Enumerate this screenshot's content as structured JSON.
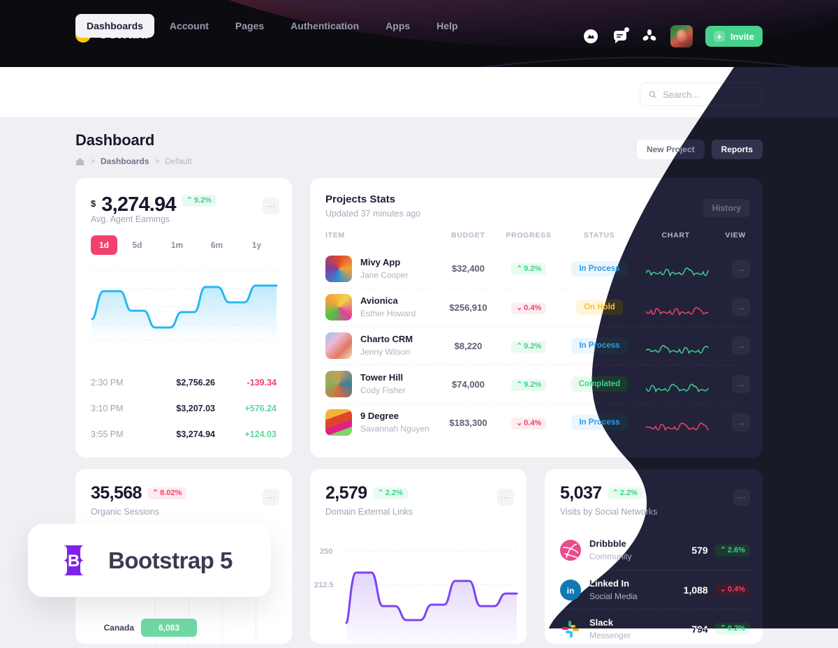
{
  "brand": {
    "name": "Oswald",
    "logo_icon": "circle-dot-logo",
    "logo_color": "#F5C60B"
  },
  "topbar": {
    "icons": [
      {
        "name": "download-icon",
        "badge": false
      },
      {
        "name": "message-icon",
        "badge": true
      },
      {
        "name": "share-icon",
        "badge": false
      }
    ],
    "avatar_name": "user-avatar",
    "invite_label": "Invite",
    "invite_color": "#47D18C"
  },
  "nav": {
    "items": [
      {
        "label": "Dashboards",
        "active": true
      },
      {
        "label": "Account",
        "active": false
      },
      {
        "label": "Pages",
        "active": false
      },
      {
        "label": "Authentication",
        "active": false
      },
      {
        "label": "Apps",
        "active": false
      },
      {
        "label": "Help",
        "active": false
      }
    ]
  },
  "search": {
    "placeholder": "Search...",
    "value": "",
    "icon": "search-icon"
  },
  "page": {
    "title": "Dashboard",
    "breadcrumb": {
      "home_icon": "home-icon",
      "sep": ">",
      "items": [
        "Dashboards",
        "Default"
      ]
    },
    "buttons": {
      "secondary": "New Project",
      "primary": "Reports"
    }
  },
  "earnings": {
    "currency": "$",
    "amount": "3,274.94",
    "change": "9.2%",
    "change_dir": "up",
    "label": "Avg. Agent Earnings",
    "menu_icon": "ellipsis-icon",
    "ranges": [
      {
        "label": "1d",
        "active": true
      },
      {
        "label": "5d",
        "active": false
      },
      {
        "label": "1m",
        "active": false
      },
      {
        "label": "6m",
        "active": false
      },
      {
        "label": "1y",
        "active": false
      }
    ],
    "transactions": [
      {
        "time": "2:30 PM",
        "value": "$2,756.26",
        "delta": "-139.34",
        "dir": "down"
      },
      {
        "time": "3:10 PM",
        "value": "$3,207.03",
        "delta": "+576.24",
        "dir": "up"
      },
      {
        "time": "3:55 PM",
        "value": "$3,274.94",
        "delta": "+124.03",
        "dir": "up"
      }
    ]
  },
  "projects": {
    "title": "Projects Stats",
    "subtitle": "Updated 37 minutes ago",
    "history_label": "History",
    "columns": [
      "ITEM",
      "BUDGET",
      "PROGRESS",
      "STATUS",
      "CHART",
      "VIEW"
    ],
    "rows": [
      {
        "name": "Mivy App",
        "person": "Jane Cooper",
        "budget": "$32,400",
        "progress": "9.2%",
        "progress_dir": "up",
        "status": "In Process",
        "status_kind": "process",
        "chart_color": "#3ECF8E",
        "view_icon": "arrow-right-icon"
      },
      {
        "name": "Avionica",
        "person": "Esther Howard",
        "budget": "$256,910",
        "progress": "0.4%",
        "progress_dir": "down",
        "status": "On Hold",
        "status_kind": "hold",
        "chart_color": "#F1416C",
        "view_icon": "arrow-right-icon"
      },
      {
        "name": "Charto CRM",
        "person": "Jenny Wilson",
        "budget": "$8,220",
        "progress": "9.2%",
        "progress_dir": "up",
        "status": "In Process",
        "status_kind": "process",
        "chart_color": "#3ECF8E",
        "view_icon": "arrow-right-icon"
      },
      {
        "name": "Tower Hill",
        "person": "Cody Fisher",
        "budget": "$74,000",
        "progress": "9.2%",
        "progress_dir": "up",
        "status": "Complated",
        "status_kind": "complete",
        "chart_color": "#3ECF8E",
        "view_icon": "arrow-right-icon"
      },
      {
        "name": "9 Degree",
        "person": "Savannah Nguyen",
        "budget": "$183,300",
        "progress": "0.4%",
        "progress_dir": "down",
        "status": "In Process",
        "status_kind": "process",
        "chart_color": "#F1416C",
        "view_icon": "arrow-right-icon"
      }
    ]
  },
  "organic": {
    "number": "35,568",
    "change": "8.02%",
    "change_dir": "up",
    "change_kind": "red",
    "label": "Organic Sessions",
    "menu_icon": "ellipsis-icon",
    "bar_label": "Canada",
    "bar_value": "6,083"
  },
  "domain": {
    "number": "2,579",
    "change": "2.2%",
    "change_dir": "up",
    "label": "Domain External Links",
    "menu_icon": "ellipsis-icon",
    "y_ticks": [
      "250",
      "212.5"
    ]
  },
  "social": {
    "number": "5,037",
    "change": "2.2%",
    "change_dir": "up",
    "label": "Visits by Social Networks",
    "menu_icon": "ellipsis-icon",
    "rows": [
      {
        "name": "Dribbble",
        "category": "Community",
        "value": "579",
        "change": "2.6%",
        "dir": "up",
        "icon": "dribbble-icon"
      },
      {
        "name": "Linked In",
        "category": "Social Media",
        "value": "1,088",
        "change": "0.4%",
        "dir": "down",
        "icon": "linkedin-icon"
      },
      {
        "name": "Slack",
        "category": "Messenger",
        "value": "794",
        "change": "0.2%",
        "dir": "up",
        "icon": "slack-icon"
      }
    ]
  },
  "badge": {
    "text": "Bootstrap 5",
    "logo_icon": "bootstrap-icon",
    "logo_color": "#7E22E8"
  },
  "chart_data": [
    {
      "type": "area",
      "title": "Avg. Agent Earnings",
      "series": [
        {
          "name": "Earnings",
          "values": [
            20,
            62,
            62,
            38,
            38,
            10,
            10,
            38,
            38,
            70,
            70,
            48,
            48,
            72,
            72
          ]
        }
      ],
      "color": "#2AB7F0",
      "grid": true,
      "xlabel": "",
      "ylabel": ""
    },
    {
      "type": "area",
      "title": "Domain External Links",
      "series": [
        {
          "name": "Links",
          "values": [
            178,
            228,
            228,
            196,
            196,
            180,
            180,
            196,
            196,
            216,
            216,
            196,
            196,
            210,
            210
          ]
        }
      ],
      "color": "#7E44F0",
      "ylim": [
        175,
        250
      ],
      "yticks": [
        212.5,
        250
      ],
      "grid": true
    },
    {
      "type": "bar",
      "title": "Organic Sessions",
      "orientation": "horizontal",
      "categories": [
        "Canada"
      ],
      "values": [
        6083
      ],
      "color": "#6FD9A4",
      "grid": true
    }
  ]
}
